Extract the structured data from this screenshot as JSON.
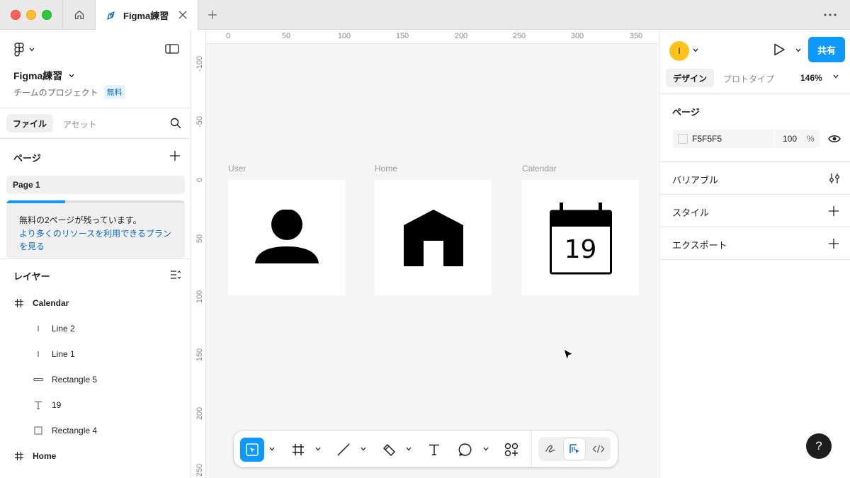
{
  "titlebar": {
    "tab_title": "Figma練習"
  },
  "file": {
    "name": "Figma練習",
    "project": "チームのプロジェクト",
    "plan_badge": "無料"
  },
  "left_tabs": {
    "file": "ファイル",
    "assets": "アセット"
  },
  "pages": {
    "title": "ページ",
    "items": [
      "Page 1"
    ]
  },
  "upsell": {
    "remaining": "無料の2ページが残っています。",
    "link": "より多くのリソースを利用できるプランを見る",
    "progress": 0.33
  },
  "layers": {
    "title": "レイヤー",
    "items": [
      {
        "label": "Calendar",
        "type": "frame",
        "icon": "frame-icon"
      },
      {
        "label": "Line 2",
        "type": "line",
        "icon": "line-icon"
      },
      {
        "label": "Line 1",
        "type": "line",
        "icon": "line-icon"
      },
      {
        "label": "Rectangle 5",
        "type": "rect-thin",
        "icon": "thin-rectangle-icon"
      },
      {
        "label": "19",
        "type": "text",
        "icon": "text-icon"
      },
      {
        "label": "Rectangle 4",
        "type": "rect",
        "icon": "rectangle-icon"
      },
      {
        "label": "Home",
        "type": "frame",
        "icon": "frame-icon"
      }
    ]
  },
  "canvas": {
    "background": "#F5F5F5",
    "ruler_x": [
      "0",
      "50",
      "100",
      "150",
      "200",
      "250",
      "300",
      "350"
    ],
    "ruler_y": [
      "-100",
      "-50",
      "0",
      "50",
      "100",
      "150",
      "200",
      "250"
    ],
    "frames": [
      {
        "label": "User",
        "icon": "user-icon"
      },
      {
        "label": "Home",
        "icon": "home-icon"
      },
      {
        "label": "Calendar",
        "icon": "calendar-icon",
        "number": "19"
      }
    ]
  },
  "toolbar": {
    "tools": [
      "move-tool",
      "frame-tool",
      "line-tool",
      "pen-tool",
      "text-tool",
      "comment-tool",
      "components-tool"
    ],
    "modes": [
      "draw-mode",
      "design-mode",
      "dev-mode"
    ]
  },
  "right": {
    "avatar_initial": "I",
    "share_label": "共有",
    "tabs": {
      "design": "デザイン",
      "prototype": "プロトタイプ"
    },
    "zoom": "146%",
    "page_section": "ページ",
    "page_fill": {
      "hex": "F5F5F5",
      "opacity": "100",
      "unit": "%"
    },
    "variables": "バリアブル",
    "styles": "スタイル",
    "export": "エクスポート",
    "help": "?"
  },
  "colors": {
    "accent": "#0d99ff",
    "avatar": "#ffc21a",
    "link": "#0d6cc2"
  }
}
